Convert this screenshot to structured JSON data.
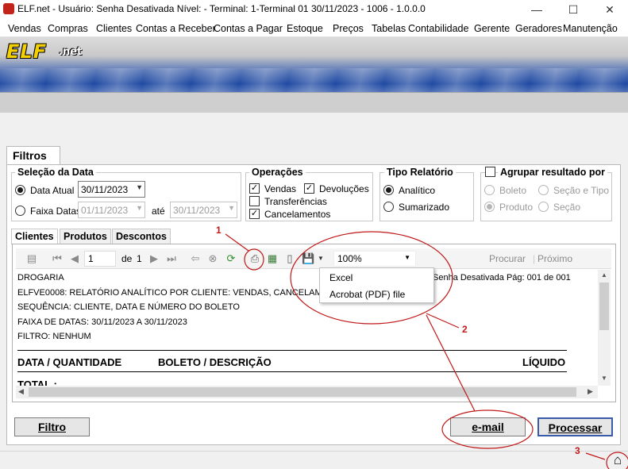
{
  "window": {
    "title": "ELF.net - Usuário: Senha Desativada   Nível: -    Terminal: 1-Terminal 01    30/11/2023 - 1006 - 1.0.0.0",
    "minimize": "—",
    "maximize": "☐",
    "close": "✕"
  },
  "menu": [
    "Vendas",
    "Compras",
    "Clientes",
    "Contas a Receber",
    "Contas a Pagar",
    "Estoque",
    "Preços",
    "Tabelas",
    "Contabilidade",
    "Gerente",
    "Geradores",
    "Manutenção"
  ],
  "banner": {
    "brand": "ELF",
    "brand_suffix": ".net"
  },
  "filters": {
    "tab_label": "Filtros",
    "date_selection": {
      "legend": "Seleção da Data",
      "current_label": "Data Atual",
      "current_value": "30/11/2023",
      "range_label": "Faixa Datas",
      "range_from": "01/11/2023",
      "range_to_label": "até",
      "range_to": "30/11/2023"
    },
    "operations": {
      "legend": "Operações",
      "vendas": "Vendas",
      "devolucoes": "Devoluções",
      "transferencias": "Transferências",
      "cancelamentos": "Cancelamentos"
    },
    "report_type": {
      "legend": "Tipo Relatório",
      "analitico": "Analítico",
      "sumarizado": "Sumarizado"
    },
    "group_by": {
      "legend": "Agrupar resultado por",
      "boleto": "Boleto",
      "secao_tipo": "Seção e Tipo",
      "produto": "Produto",
      "secao": "Seção"
    }
  },
  "subtabs": [
    "Clientes",
    "Produtos",
    "Descontos"
  ],
  "viewer": {
    "page_input": "1",
    "of_label": "de",
    "total_pages": "1",
    "zoom": "100%",
    "search_label": "Procurar",
    "next_label": "Próximo",
    "export_options": [
      "Excel",
      "Acrobat (PDF) file"
    ]
  },
  "report": {
    "company": "DROGARIA",
    "title": "ELFVE0008: RELATÓRIO ANALÍTICO POR CLIENTE: VENDAS, CANCELAM",
    "page_info": "Senha Desativada Pág: 001 de 001",
    "sequence": "SEQUÊNCIA: CLIENTE, DATA E NÚMERO DO BOLETO",
    "date_range": "FAIXA DE DATAS: 30/11/2023 A 30/11/2023",
    "filter": "FILTRO: NENHUM",
    "columns": [
      "DATA / QUANTIDADE",
      "BOLETO / DESCRIÇÃO",
      "LÍQUIDO"
    ],
    "total_label": "TOTAL :"
  },
  "buttons": {
    "filtro": "Filtro",
    "email": "e-mail",
    "processar": "Processar"
  },
  "annotations": [
    "1",
    "2",
    "3"
  ],
  "colors": {
    "annotation": "#c01818",
    "banner_blue": "#1f4aa3",
    "brand_yellow": "#f5d000"
  }
}
